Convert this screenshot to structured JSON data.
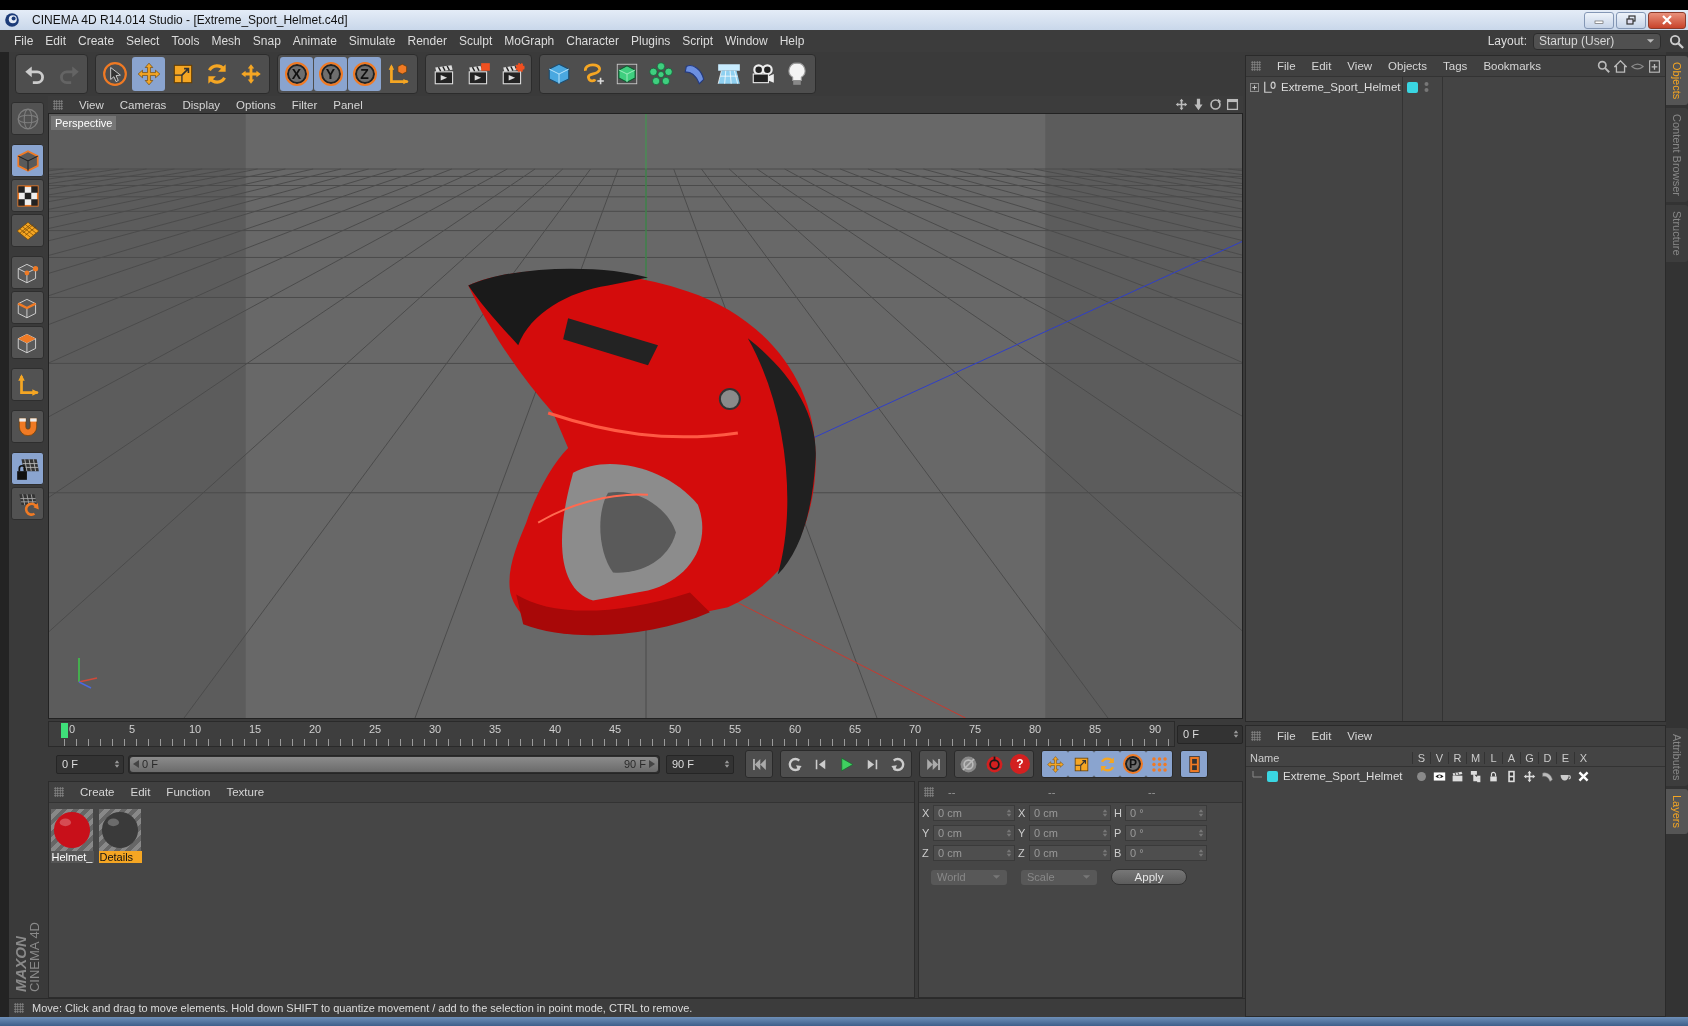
{
  "window": {
    "title": "CINEMA 4D R14.014 Studio - [Extreme_Sport_Helmet.c4d]"
  },
  "menu_bar": {
    "items": [
      "File",
      "Edit",
      "Create",
      "Select",
      "Tools",
      "Mesh",
      "Snap",
      "Animate",
      "Simulate",
      "Render",
      "Sculpt",
      "MoGraph",
      "Character",
      "Plugins",
      "Script",
      "Window",
      "Help"
    ],
    "layout_label": "Layout:",
    "layout_value": "Startup (User)"
  },
  "toolbar": {
    "groups": [
      {
        "items": [
          {
            "kind": "undo",
            "selected": false,
            "disabled": false
          },
          {
            "kind": "redo",
            "selected": false,
            "disabled": true
          }
        ]
      },
      {
        "items": [
          {
            "kind": "live_select",
            "selected": false,
            "disabled": false
          },
          {
            "kind": "move",
            "selected": true,
            "disabled": false
          },
          {
            "kind": "scale",
            "selected": false,
            "disabled": false
          },
          {
            "kind": "rotate",
            "selected": false,
            "disabled": false
          },
          {
            "kind": "recent_tool",
            "selected": false,
            "disabled": false
          }
        ]
      },
      {
        "items": [
          {
            "kind": "axis_lock",
            "label": "X",
            "selected": true,
            "disabled": false
          },
          {
            "kind": "axis_lock",
            "label": "Y",
            "selected": true,
            "disabled": false
          },
          {
            "kind": "axis_lock",
            "label": "Z",
            "selected": true,
            "disabled": false
          },
          {
            "kind": "coordinate_system",
            "selected": false,
            "disabled": false
          }
        ]
      },
      {
        "items": [
          {
            "kind": "render_view",
            "selected": false,
            "disabled": false
          },
          {
            "kind": "render_to_viewer",
            "selected": false,
            "disabled": false
          },
          {
            "kind": "render_settings",
            "selected": false,
            "disabled": false
          }
        ]
      },
      {
        "items": [
          {
            "kind": "cube",
            "selected": false,
            "disabled": false
          },
          {
            "kind": "spline_pen",
            "selected": false,
            "disabled": false
          },
          {
            "kind": "subdivision",
            "selected": false,
            "disabled": false
          },
          {
            "kind": "array",
            "selected": false,
            "disabled": false
          },
          {
            "kind": "deformer",
            "selected": false,
            "disabled": false
          },
          {
            "kind": "floor",
            "selected": false,
            "disabled": false
          },
          {
            "kind": "camera",
            "selected": false,
            "disabled": false
          },
          {
            "kind": "light",
            "selected": false,
            "disabled": false
          }
        ]
      }
    ]
  },
  "mode_toolbar": {
    "groups": [
      {
        "items": [
          {
            "kind": "view_mode",
            "selected": false,
            "disabled": true
          }
        ]
      },
      {
        "items": [
          {
            "kind": "model",
            "selected": true,
            "disabled": false
          },
          {
            "kind": "texture",
            "selected": false,
            "disabled": false
          },
          {
            "kind": "workplane",
            "selected": false,
            "disabled": false
          }
        ]
      },
      {
        "items": [
          {
            "kind": "points",
            "selected": false,
            "disabled": false
          },
          {
            "kind": "edges",
            "selected": false,
            "disabled": false
          },
          {
            "kind": "polygons",
            "selected": false,
            "disabled": false
          }
        ]
      },
      {
        "items": [
          {
            "kind": "axis",
            "selected": false,
            "disabled": false
          }
        ]
      },
      {
        "items": [
          {
            "kind": "snap",
            "selected": false,
            "disabled": false
          }
        ]
      },
      {
        "items": [
          {
            "kind": "lock_workplane",
            "selected": true,
            "disabled": false
          },
          {
            "kind": "planar_workplane",
            "selected": false,
            "disabled": false
          }
        ]
      }
    ]
  },
  "viewport": {
    "menu": [
      "View",
      "Cameras",
      "Display",
      "Options",
      "Filter",
      "Panel"
    ],
    "camera_label": "Perspective"
  },
  "timeline": {
    "ticks": [
      "0",
      "5",
      "10",
      "15",
      "20",
      "25",
      "30",
      "35",
      "40",
      "45",
      "50",
      "55",
      "60",
      "65",
      "70",
      "75",
      "80",
      "85",
      "90"
    ],
    "playhead": {
      "level": 0
    },
    "frame_field": "0 F"
  },
  "transport": {
    "start_field": "0 F",
    "range": {
      "start": "0 F",
      "end": "90 F",
      "level": 1
    },
    "end_field": "90 F",
    "groups": [
      {
        "items": [
          {
            "kind": "first",
            "selected": false
          }
        ]
      },
      {
        "items": [
          {
            "kind": "prev_key",
            "selected": false
          },
          {
            "kind": "prev_frame",
            "selected": false
          },
          {
            "kind": "play",
            "selected": false
          },
          {
            "kind": "next_frame",
            "selected": false
          },
          {
            "kind": "next_key",
            "selected": false
          }
        ]
      },
      {
        "items": [
          {
            "kind": "last",
            "selected": false
          }
        ]
      },
      {
        "items": [
          {
            "kind": "record",
            "selected": false
          },
          {
            "kind": "autokey",
            "selected": false
          },
          {
            "kind": "key_selection",
            "label": "?",
            "selected": false
          }
        ]
      },
      {
        "items": [
          {
            "kind": "key_move",
            "selected": true
          },
          {
            "kind": "key_scale",
            "selected": true
          },
          {
            "kind": "key_rotate",
            "selected": true
          },
          {
            "kind": "key_param",
            "label": "P",
            "selected": true
          },
          {
            "kind": "key_points",
            "selected": true
          }
        ]
      },
      {
        "items": [
          {
            "kind": "timeline_window",
            "selected": true
          }
        ]
      }
    ]
  },
  "materials": {
    "menu": [
      "Create",
      "Edit",
      "Function",
      "Texture"
    ],
    "items": [
      {
        "name": "Helmet_",
        "color": "#c8101a",
        "selected": false
      },
      {
        "name": "Details",
        "color": "#3a3a3a",
        "selected": true
      }
    ]
  },
  "coordinates": {
    "headers": [
      "--",
      "--",
      "--"
    ],
    "rows": [
      {
        "position_axis": "X",
        "position": "0 cm",
        "size_axis": "X",
        "size": "0 cm",
        "rotation_axis": "H",
        "rotation": "0 °"
      },
      {
        "position_axis": "Y",
        "position": "0 cm",
        "size_axis": "Y",
        "size": "0 cm",
        "rotation_axis": "P",
        "rotation": "0 °"
      },
      {
        "position_axis": "Z",
        "position": "0 cm",
        "size_axis": "Z",
        "size": "0 cm",
        "rotation_axis": "B",
        "rotation": "0 °"
      }
    ],
    "coord_mode": "World",
    "size_mode": "Scale",
    "apply": "Apply"
  },
  "objects_panel": {
    "menu": [
      "File",
      "Edit",
      "View",
      "Objects",
      "Tags",
      "Bookmarks"
    ],
    "objects": [
      {
        "name": "Extreme_Sport_Helmet",
        "color": "#3ad6e2",
        "expanded": false
      }
    ]
  },
  "layers_panel": {
    "menu": [
      "File",
      "Edit",
      "View"
    ],
    "columns": [
      "Name",
      "S",
      "V",
      "R",
      "M",
      "L",
      "A",
      "G",
      "D",
      "E",
      "X"
    ],
    "layers": [
      {
        "name": "Extreme_Sport_Helmet",
        "color": "#3ad6e2"
      }
    ]
  },
  "side_tabs": {
    "upper": [
      {
        "label": "Objects",
        "selected": true
      },
      {
        "label": "Content Browser",
        "selected": false
      },
      {
        "label": "Structure",
        "selected": false
      }
    ],
    "lower": [
      {
        "label": "Attributes",
        "selected": false
      },
      {
        "label": "Layers",
        "selected": true
      }
    ]
  },
  "branding": {
    "line1": "MAXON",
    "line2": "CINEMA 4D"
  },
  "status_bar": {
    "text": "Move: Click and drag to move elements. Hold down SHIFT to quantize movement / add to the selection in point mode, CTRL to remove."
  }
}
